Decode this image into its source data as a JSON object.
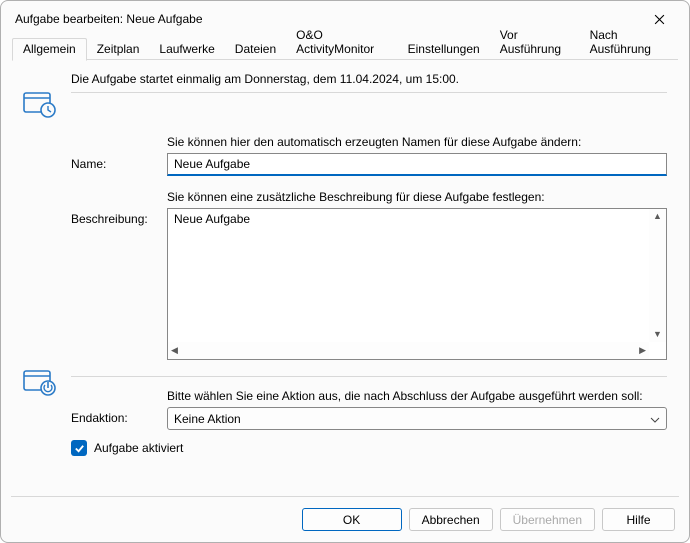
{
  "window": {
    "title": "Aufgabe bearbeiten: Neue Aufgabe"
  },
  "tabs": {
    "items": [
      "Allgemein",
      "Zeitplan",
      "Laufwerke",
      "Dateien",
      "O&O ActivityMonitor",
      "Einstellungen",
      "Vor Ausführung",
      "Nach Ausführung"
    ],
    "active_index": 0
  },
  "general": {
    "summary": "Die Aufgabe startet einmalig am Donnerstag, dem 11.04.2024, um 15:00.",
    "name_label": "Name:",
    "name_hint": "Sie können hier den automatisch erzeugten Namen für diese Aufgabe ändern:",
    "name_value": "Neue Aufgabe",
    "desc_label": "Beschreibung:",
    "desc_hint": "Sie können eine zusätzliche Beschreibung für diese Aufgabe festlegen:",
    "desc_value": "Neue Aufgabe",
    "end_hint": "Bitte wählen Sie eine Aktion aus, die nach Abschluss der Aufgabe ausgeführt werden soll:",
    "end_label": "Endaktion:",
    "end_value": "Keine Aktion",
    "activate_label": "Aufgabe aktiviert",
    "activate_checked": true
  },
  "buttons": {
    "ok": "OK",
    "cancel": "Abbrechen",
    "apply": "Übernehmen",
    "help": "Hilfe"
  }
}
